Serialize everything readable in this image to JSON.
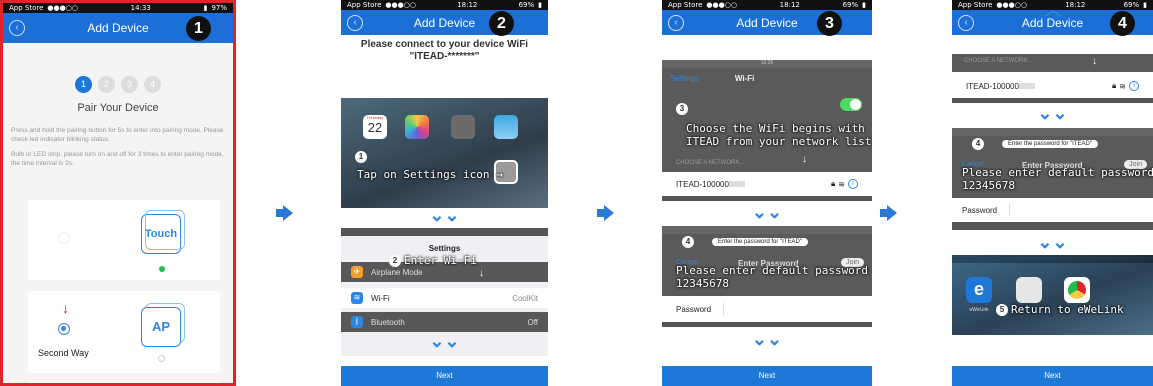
{
  "status": {
    "s1": {
      "carrier": "App Store",
      "signal": "●●●○○",
      "time": "14:33",
      "battery": "97%"
    },
    "s2": {
      "carrier": "App Store",
      "signal": "●●●○○",
      "time": "18:12",
      "battery": "69%"
    },
    "s3": {
      "carrier": "App Store",
      "signal": "●●●○○",
      "time": "18:12",
      "battery": "69%"
    },
    "s4": {
      "carrier": "App Store",
      "signal": "●●●○○",
      "time": "18:12",
      "battery": "69%"
    }
  },
  "nav": {
    "title": "Add Device"
  },
  "steps": {
    "n1": "1",
    "n2": "2",
    "n3": "3",
    "n4": "4"
  },
  "panel1": {
    "progress": [
      "1",
      "2",
      "3",
      "4"
    ],
    "heading": "Pair Your Device",
    "instructions": "Press and hold the pairing button for 5s to enter into pairing mode. Please check led indicator blinking status.",
    "instructions2": "Bulb or LED strip, please turn on and off for 3 times to enter pairing mode, the time interval is 2s.",
    "touch_label": "Touch",
    "ap_label": "AP",
    "second_way": "Second Way"
  },
  "panel2": {
    "prompt": "Please connect to your device WiFi \"ITEAD-*******\"",
    "callout1": "Tap on Settings icon",
    "calendar_day": "Thursday",
    "calendar_date": "22",
    "settings_title": "Settings",
    "callout2": "Enter Wi-Fi",
    "row_airplane": "Airplane Mode",
    "row_wifi": "Wi-Fi",
    "row_wifi_value": "CoolKit",
    "row_bluetooth": "Bluetooth",
    "row_bluetooth_value": "Off",
    "next": "Next"
  },
  "panel3": {
    "back_settings": "Settings",
    "wifi_title": "Wi-Fi",
    "wifi_time": "12:26",
    "callout3": "Choose the WiFi begins with\nITEAD from your network list",
    "network_header": "CHOOSE A NETWORK...",
    "network_name": "ITEAD-100000",
    "pw_banner": "Enter the password for \"ITEAD\"",
    "cancel": "Cancel",
    "enter_password": "Enter Password",
    "join": "Join",
    "callout4": "Please enter default password\n12345678",
    "password_label": "Password",
    "next": "Next"
  },
  "panel4": {
    "network_header": "CHOOSE A NETWORK...",
    "network_name": "ITEAD-100000",
    "pw_banner": "Enter the password for \"ITEAD\"",
    "cancel": "Cancel",
    "enter_password": "Enter Password",
    "join": "Join",
    "callout4": "Please enter default password\n12345678",
    "password_label": "Password",
    "callout5": "Return to eWeLink",
    "ewelink_label": "eWeLink",
    "next": "Next"
  }
}
